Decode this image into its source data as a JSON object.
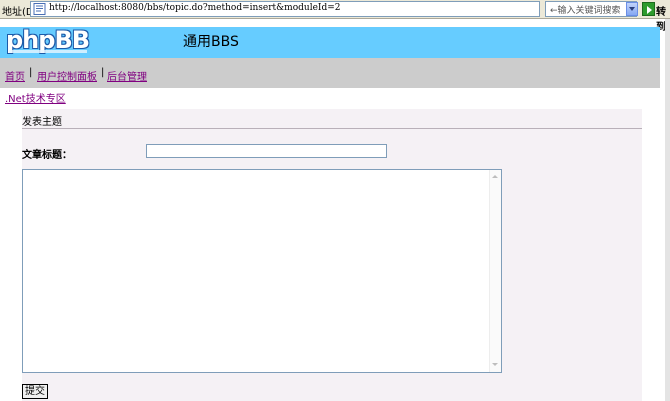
{
  "browser": {
    "address_label": "地址(D)",
    "url": "http://localhost:8080/bbs/topic.do?method=insert&moduleId=2",
    "search_placeholder": "←输入关键词搜索",
    "go_label": "转到"
  },
  "header": {
    "logo_text": "phpBB",
    "site_title": "通用BBS"
  },
  "nav": {
    "home": "首页",
    "separator": "|",
    "user_panel": "用户控制面板",
    "admin": "后台管理"
  },
  "module_link": ".Net技术专区",
  "form": {
    "section_title": "发表主题",
    "title_label": "文章标题：",
    "title_value": "",
    "content_value": "",
    "submit_label": "提交"
  },
  "colors": {
    "header_bg": "#66ccff",
    "nav_bg": "#cccccc",
    "link": "#800080",
    "panel_bg": "#f5f1f5"
  }
}
